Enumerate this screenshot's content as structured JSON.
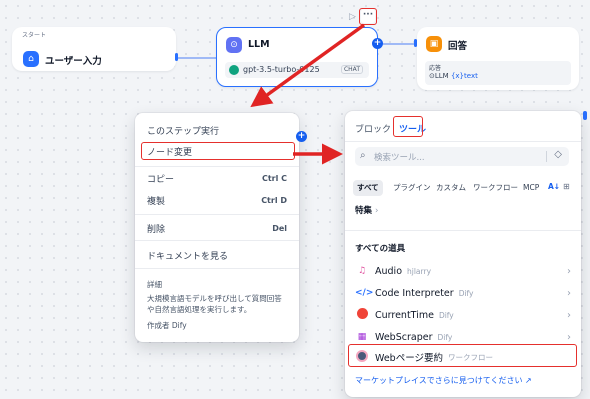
{
  "canvas": {
    "start_node": {
      "caption": "スタート",
      "title": "ユーザー入力"
    },
    "llm_node": {
      "title": "LLM",
      "model": "gpt-3.5-turbo-0125",
      "model_tag": "CHAT"
    },
    "answer_node": {
      "title": "回答",
      "field_label": "応答",
      "var_source": "LLM",
      "var_name": "text"
    },
    "toolbar": {
      "run_icon": "▷",
      "more_icon": "···"
    }
  },
  "context_menu": {
    "run_step": "このステップ実行",
    "change_node": "ノード変更",
    "copy": "コピー",
    "copy_key": "Ctrl C",
    "duplicate": "複製",
    "duplicate_key": "Ctrl D",
    "delete": "削除",
    "delete_key": "Del",
    "view_docs": "ドキュメントを見る",
    "about_title": "詳細",
    "about_desc": "大規模言語モデルを呼び出して質問回答や自然言語処理を実行します。",
    "author": "作成者 Dify"
  },
  "tool_panel": {
    "tabs": [
      "ブロック",
      "ツール"
    ],
    "search_placeholder": "検索ツール...",
    "filters": [
      "すべて",
      "プラグイン",
      "カスタム",
      "ワークフロー",
      "MCP"
    ],
    "featured": "特集",
    "all_tools": "すべての道具",
    "tools": [
      {
        "name": "Audio",
        "author": "hjlarry",
        "icon": "audio-icon"
      },
      {
        "name": "Code Interpreter",
        "author": "Dify",
        "icon": "code-icon"
      },
      {
        "name": "CurrentTime",
        "author": "Dify",
        "icon": "clock-icon"
      },
      {
        "name": "WebScraper",
        "author": "Dify",
        "icon": "scraper-icon"
      },
      {
        "name": "Webページ要約",
        "author": "ワークフロー",
        "icon": "workflow-avatar-icon"
      }
    ],
    "marketplace_link": "マーケットプレイスでさらに見つけてください ↗"
  },
  "colors": {
    "accent": "#155eef",
    "highlight": "#e5302d",
    "arrow": "#e02424"
  }
}
